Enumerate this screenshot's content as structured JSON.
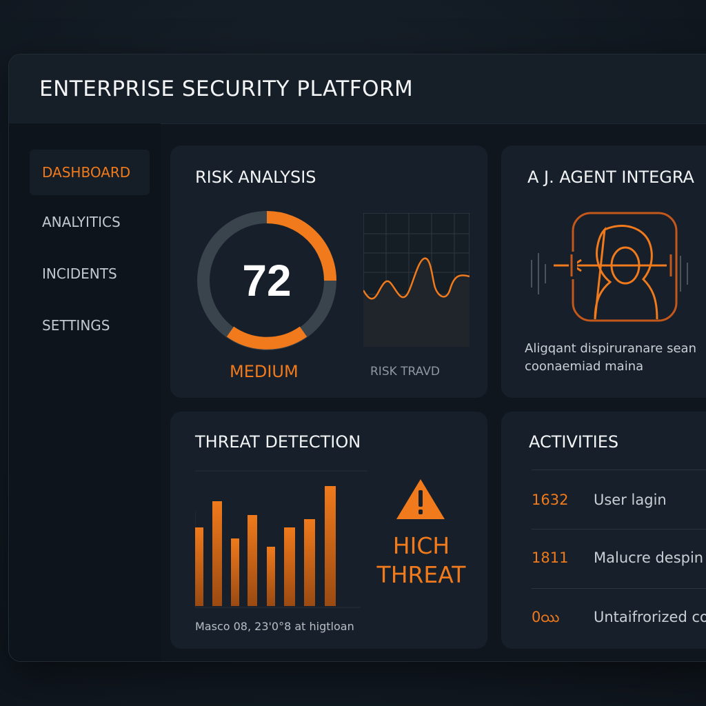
{
  "app": {
    "title": "ENTERPRISE SECURITY PLATFORM"
  },
  "sidebar": {
    "items": [
      {
        "label": "DASHBOARD",
        "active": true
      },
      {
        "label": "ANALYITICS",
        "active": false
      },
      {
        "label": "INCIDENTS",
        "active": false
      },
      {
        "label": "SETTINGS",
        "active": false
      }
    ]
  },
  "risk_analysis": {
    "title": "RISK ANALYSIS",
    "score": "72",
    "score_value": 72,
    "level": "MEDIUM",
    "trend_caption": "RISK TRAVD"
  },
  "agent_integration": {
    "title": "A J. AGENT INTEGRA",
    "icon": "agent-head-icon",
    "description_line1": "Aligqant dispiruranare sean",
    "description_line2": "coonaemiad maina"
  },
  "threat_detection": {
    "title": "THREAT DETECTION",
    "level_line1": "HICH",
    "level_line2": "THREAT",
    "icon": "warning-icon",
    "caption": "Masco  08, 23'0°8 at higtloan"
  },
  "activities": {
    "title": "ACTIVITIES",
    "items": [
      {
        "id": "1632",
        "text": "User lagin"
      },
      {
        "id": "1811",
        "text": "Malucre despin"
      },
      {
        "id": "0యి",
        "text": "Untaifrorized co"
      }
    ]
  },
  "colors": {
    "accent": "#f07a1c",
    "background": "#0f161e",
    "card": "#17202a",
    "text": "#f2f4f6"
  }
}
